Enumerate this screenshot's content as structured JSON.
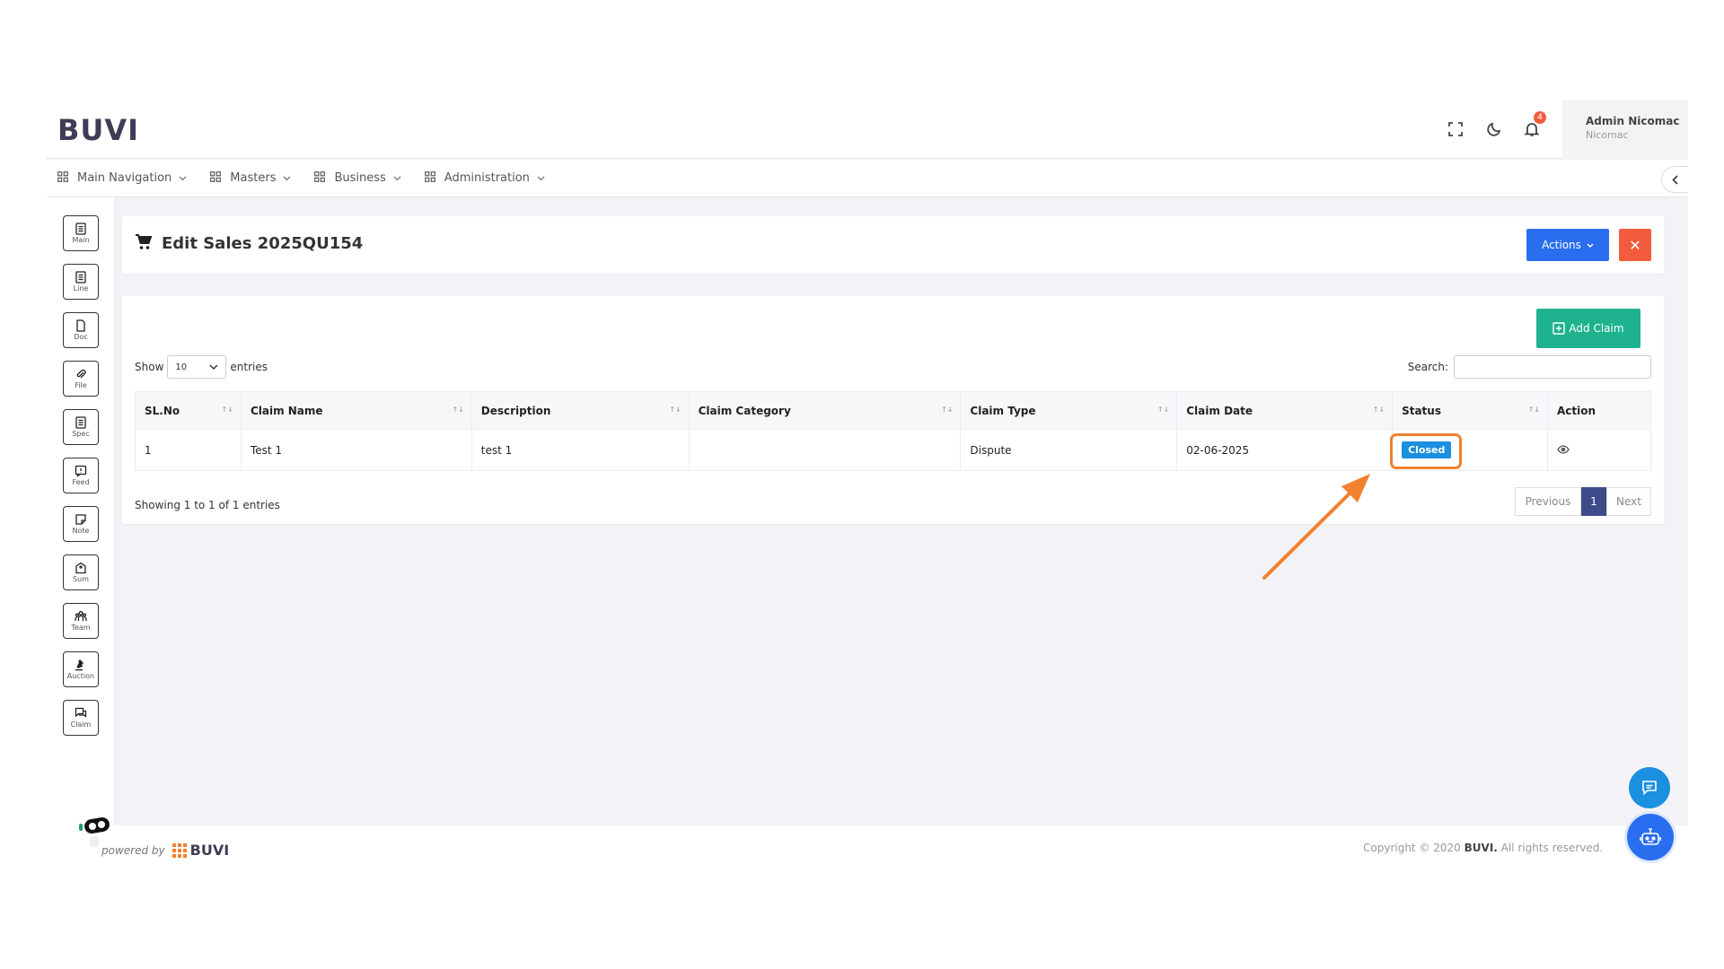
{
  "header": {
    "logo": "BUVI",
    "notifications_count": "4",
    "user_name": "Admin Nicomac",
    "user_org": "Nicomac"
  },
  "nav": {
    "items": [
      {
        "label": "Main Navigation"
      },
      {
        "label": "Masters"
      },
      {
        "label": "Business"
      },
      {
        "label": "Administration"
      }
    ]
  },
  "sidebar": {
    "items": [
      {
        "label": "Main"
      },
      {
        "label": "Line"
      },
      {
        "label": "Doc"
      },
      {
        "label": "File"
      },
      {
        "label": "Spec"
      },
      {
        "label": "Feed"
      },
      {
        "label": "Note"
      },
      {
        "label": "Sum"
      },
      {
        "label": "Team"
      },
      {
        "label": "Auction"
      },
      {
        "label": "Claim"
      }
    ]
  },
  "page": {
    "title": "Edit Sales 2025QU154",
    "actions_label": "Actions",
    "close_label": "✕"
  },
  "table_section": {
    "add_label": "Add Claim",
    "show_label": "Show",
    "entries_value": "10",
    "entries_label": "entries",
    "search_label": "Search:",
    "columns": [
      "SL.No",
      "Claim Name",
      "Description",
      "Claim Category",
      "Claim Type",
      "Claim Date",
      "Status",
      "Action"
    ],
    "rows": [
      {
        "sl": "1",
        "name": "Test 1",
        "description": "test 1",
        "category": "",
        "type": "Dispute",
        "date": "02-06-2025",
        "status": "Closed"
      }
    ],
    "showing_text": "Showing 1 to 1 of 1 entries",
    "pager": {
      "previous": "Previous",
      "current": "1",
      "next": "Next"
    }
  },
  "footer": {
    "powered_by": "powered by",
    "brand": "BUVI",
    "copyright_prefix": "Copyright © 2020",
    "copyright_brand": "BUVI.",
    "copyright_suffix": "All rights reserved."
  },
  "colors": {
    "primary": "#2a6ef0",
    "danger": "#f25c3c",
    "success": "#1fb28f",
    "status_closed": "#1b8fe0",
    "highlight": "#f0812f",
    "pager_active": "#3d4b8a"
  }
}
